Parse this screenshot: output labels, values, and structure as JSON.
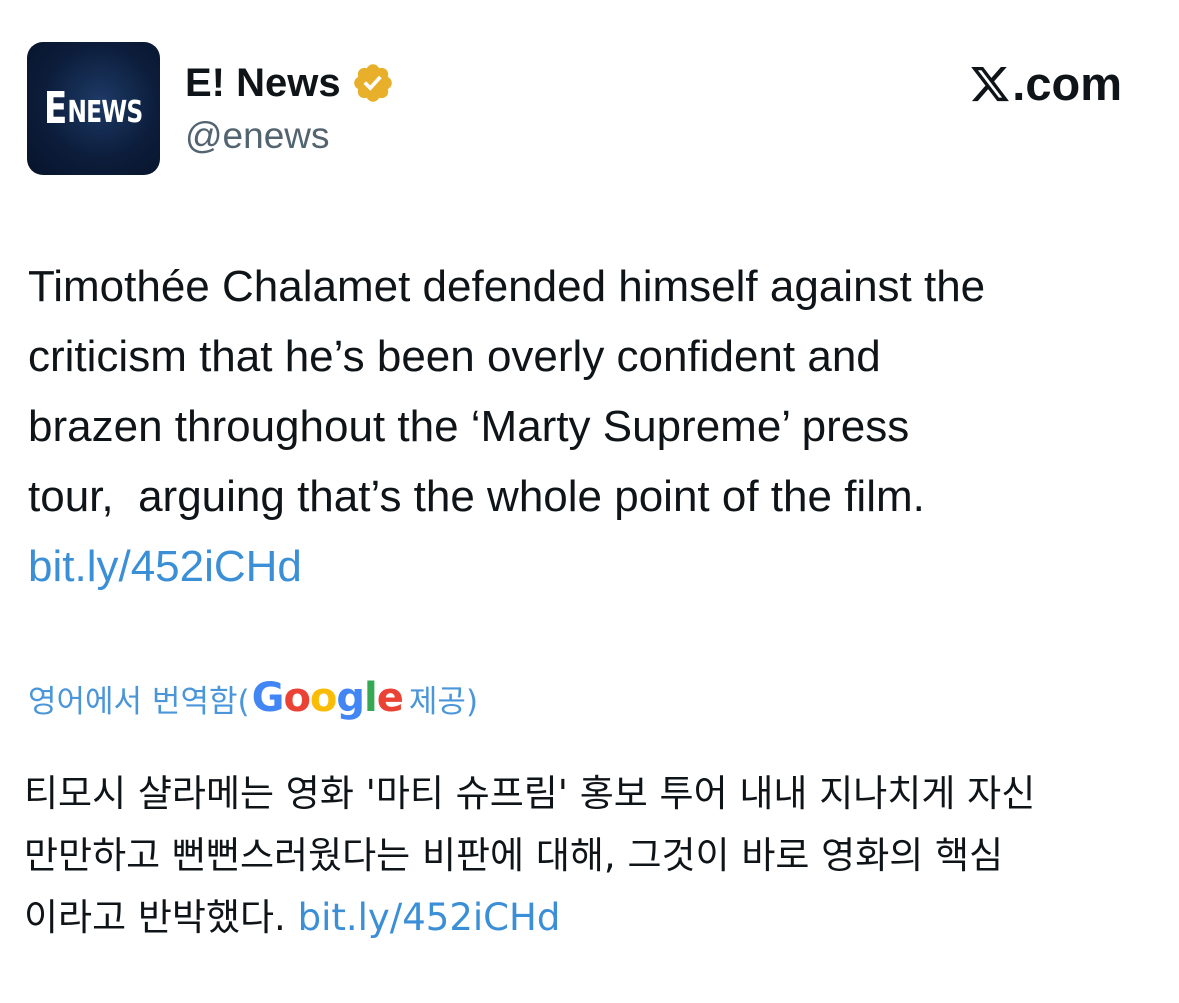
{
  "account": {
    "display_name": "E! News",
    "handle": "@enews",
    "avatar_logo_e": "E",
    "avatar_logo_news": "NEWS",
    "verified": "verified-gold-badge-icon"
  },
  "brand": {
    "site": ".com",
    "logo": "x-logo-icon"
  },
  "tweet": {
    "line1": "Timothée Chalamet defended himself against the",
    "line2": "criticism that he’s been overly confident and",
    "line3": "brazen throughout the ‘Marty Supreme’ press",
    "line4": "tour,  arguing that’s the whole point of the film.",
    "link": "bit.ly/452iCHd"
  },
  "translation": {
    "prefix": "영어에서 번역함(",
    "provider": "Google",
    "suffix": " 제공)",
    "line1": "티모시 샬라메는 영화 '마티 슈프림' 홍보 투어 내내 지나치게 자신",
    "line2": "만만하고 뻔뻔스러웠다는 비판에 대해, 그것이 바로 영화의 핵심",
    "line3": "이라고 반박했다. ",
    "link": "bit.ly/452iCHd"
  },
  "colors": {
    "link": "#3b8fd6",
    "text": "#0f1419",
    "muted": "#536471",
    "verified": "#e8b02a"
  }
}
